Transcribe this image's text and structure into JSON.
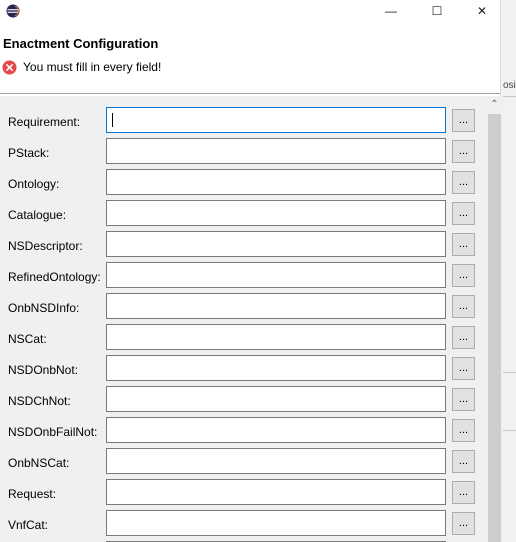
{
  "window": {
    "title": "",
    "minimize_glyph": "—",
    "maximize_glyph": "☐",
    "close_glyph": "✕"
  },
  "header": {
    "title": "Enactment Configuration",
    "error_icon": "error-circle-icon",
    "error_message": "You must fill in every field!"
  },
  "fields": [
    {
      "label": "Requirement:",
      "value": "",
      "focused": true
    },
    {
      "label": "PStack:",
      "value": ""
    },
    {
      "label": "Ontology:",
      "value": ""
    },
    {
      "label": "Catalogue:",
      "value": ""
    },
    {
      "label": "NSDescriptor:",
      "value": ""
    },
    {
      "label": "RefinedOntology:",
      "value": ""
    },
    {
      "label": "OnbNSDInfo:",
      "value": ""
    },
    {
      "label": "NSCat:",
      "value": ""
    },
    {
      "label": "NSDOnbNot:",
      "value": ""
    },
    {
      "label": "NSDChNot:",
      "value": ""
    },
    {
      "label": "NSDOnbFailNot:",
      "value": ""
    },
    {
      "label": "OnbNSCat:",
      "value": ""
    },
    {
      "label": "Request:",
      "value": ""
    },
    {
      "label": "VnfCat:",
      "value": ""
    },
    {
      "label": "",
      "value": ""
    }
  ],
  "browse_label": "...",
  "background_fragment": "osi",
  "colors": {
    "error_red": "#e5484d",
    "focus_blue": "#0078d7",
    "form_bg": "#f0f0f0"
  }
}
